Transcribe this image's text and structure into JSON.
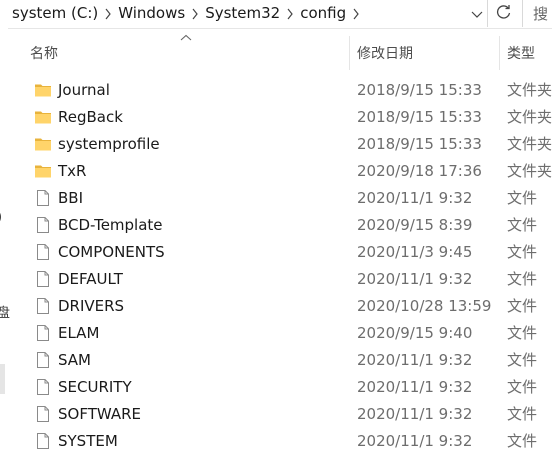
{
  "address_bar": {
    "crumbs": [
      "system (C:)",
      "Windows",
      "System32",
      "config"
    ],
    "search_hint": "搜"
  },
  "columns": {
    "name": "名称",
    "date": "修改日期",
    "type": "类型"
  },
  "nav": {
    "glyph_1": ")",
    "glyph_2": "盘"
  },
  "files": [
    {
      "name": "Journal",
      "date": "2018/9/15 15:33",
      "type": "文件夹",
      "kind": "folder"
    },
    {
      "name": "RegBack",
      "date": "2018/9/15 15:33",
      "type": "文件夹",
      "kind": "folder"
    },
    {
      "name": "systemprofile",
      "date": "2018/9/15 15:33",
      "type": "文件夹",
      "kind": "folder"
    },
    {
      "name": "TxR",
      "date": "2020/9/18 17:36",
      "type": "文件夹",
      "kind": "folder"
    },
    {
      "name": "BBI",
      "date": "2020/11/1 9:32",
      "type": "文件",
      "kind": "file"
    },
    {
      "name": "BCD-Template",
      "date": "2020/9/15 8:39",
      "type": "文件",
      "kind": "file"
    },
    {
      "name": "COMPONENTS",
      "date": "2020/11/3 9:45",
      "type": "文件",
      "kind": "file"
    },
    {
      "name": "DEFAULT",
      "date": "2020/11/1 9:32",
      "type": "文件",
      "kind": "file"
    },
    {
      "name": "DRIVERS",
      "date": "2020/10/28 13:59",
      "type": "文件",
      "kind": "file"
    },
    {
      "name": "ELAM",
      "date": "2020/9/15 9:40",
      "type": "文件",
      "kind": "file"
    },
    {
      "name": "SAM",
      "date": "2020/11/1 9:32",
      "type": "文件",
      "kind": "file"
    },
    {
      "name": "SECURITY",
      "date": "2020/11/1 9:32",
      "type": "文件",
      "kind": "file"
    },
    {
      "name": "SOFTWARE",
      "date": "2020/11/1 9:32",
      "type": "文件",
      "kind": "file"
    },
    {
      "name": "SYSTEM",
      "date": "2020/11/1 9:32",
      "type": "文件",
      "kind": "file"
    }
  ]
}
